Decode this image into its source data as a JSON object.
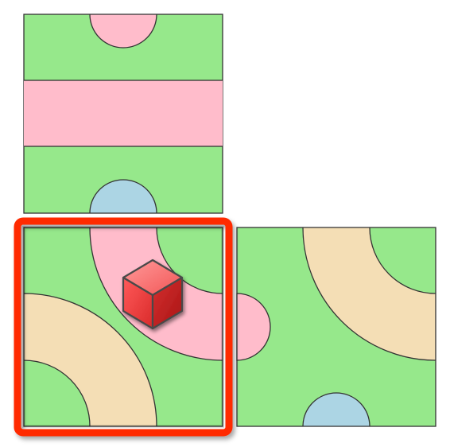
{
  "colors": {
    "background": "#ffffff",
    "tile_green": "#96e88b",
    "path_pink": "#ffbccb",
    "path_tan": "#f4deb5",
    "connector_blue": "#acd5e4",
    "outline": "#333333",
    "selection_red": "#ff2a00",
    "cube_light": "#ff8a8a",
    "cube_mid": "#f04444",
    "cube_dark": "#b81e1e"
  },
  "board": {
    "tiles": [
      {
        "id": "tile-top",
        "paths": [
          "pink-half-circle-top",
          "pink-horizontal-band"
        ],
        "connectors": [
          "blue-half-circle-bottom"
        ]
      },
      {
        "id": "tile-bottom-left",
        "paths": [
          "pink-arc",
          "tan-arc"
        ],
        "selected": true
      },
      {
        "id": "tile-bottom-right",
        "paths": [
          "tan-arc"
        ],
        "connectors": [
          "pink-half-circle-left",
          "blue-half-circle-bottom"
        ]
      }
    ],
    "player_piece": {
      "icon": "red-cube-icon",
      "tile": "tile-bottom-left"
    }
  }
}
